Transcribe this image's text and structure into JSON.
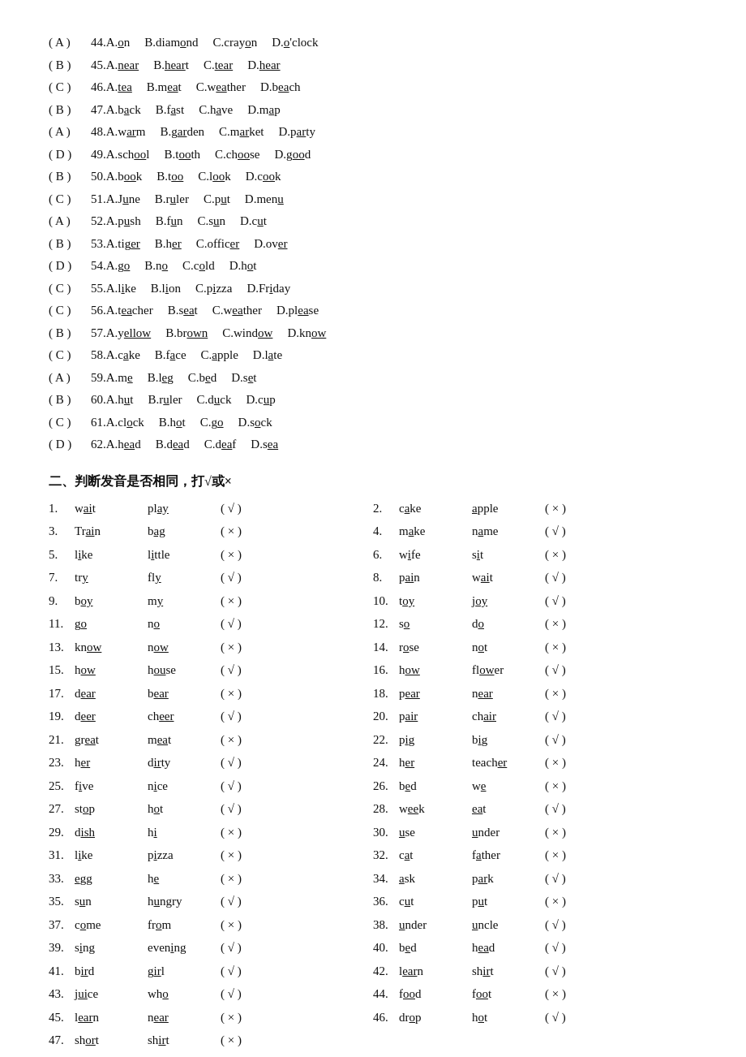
{
  "section1": {
    "title": "",
    "rows": [
      {
        "answer": "( A )",
        "items": [
          "44.A.<u>o</u>n",
          "B.diam<u>o</u>nd",
          "C.cray<u>o</u>n",
          "D.<u>o</u>'clock"
        ]
      },
      {
        "answer": "( B )",
        "items": [
          "45.A.<u>near</u>",
          "B.<u>hear</u>t",
          "C.<u>tear</u>",
          "D.<u>hear</u>"
        ]
      },
      {
        "answer": "( C )",
        "items": [
          "46.A.<u>tea</u>",
          "B.m<u>ea</u>t",
          "C.w<u>ea</u>ther",
          "D.b<u>ea</u>ch"
        ]
      },
      {
        "answer": "( B )",
        "items": [
          "47.A.b<u>a</u>ck",
          "B.f<u>a</u>st",
          "C.h<u>a</u>ve",
          "D.m<u>a</u>p"
        ]
      },
      {
        "answer": "( A )",
        "items": [
          "48.A.w<u>ar</u>m",
          "B.g<u>ar</u>den",
          "C.m<u>ar</u>ket",
          "D.p<u>ar</u>ty"
        ]
      },
      {
        "answer": "( D )",
        "items": [
          "49.A.sch<u>oo</u>l",
          "B.t<u>oo</u>th",
          "C.ch<u>oo</u>se",
          "D.g<u>oo</u>d"
        ]
      },
      {
        "answer": "( B )",
        "items": [
          "50.A.b<u>oo</u>k",
          "B.t<u>oo</u>",
          "C.l<u>oo</u>k",
          "D.c<u>oo</u>k"
        ]
      },
      {
        "answer": "( C )",
        "items": [
          "51.A.J<u>u</u>ne",
          "B.r<u>u</u>ler",
          "C.p<u>u</u>t",
          "D.men<u>u</u>"
        ]
      },
      {
        "answer": "( A )",
        "items": [
          "52.A.p<u>u</u>sh",
          "B.f<u>u</u>n",
          "C.s<u>u</u>n",
          "D.c<u>u</u>t"
        ]
      },
      {
        "answer": "( B )",
        "items": [
          "53.A.tig<u>er</u>",
          "B.h<u>er</u>",
          "C.offic<u>er</u>",
          "D.ov<u>er</u>"
        ]
      },
      {
        "answer": "( D )",
        "items": [
          "54.A.g<u>o</u>",
          "B.n<u>o</u>",
          "C.c<u>o</u>ld",
          "D.h<u>o</u>t"
        ]
      },
      {
        "answer": "( C )",
        "items": [
          "55.A.l<u>i</u>ke",
          "B.l<u>i</u>on",
          "C.p<u>i</u>zza",
          "D.Fr<u>i</u>day"
        ]
      },
      {
        "answer": "( C )",
        "items": [
          "56.A.t<u>ea</u>cher",
          "B.s<u>ea</u>t",
          "C.w<u>ea</u>ther",
          "D.pl<u>ea</u>se"
        ]
      },
      {
        "answer": "( B )",
        "items": [
          "57.A.y<u>ellow</u>",
          "B.br<u>own</u>",
          "C.wind<u>ow</u>",
          "D.kn<u>ow</u>"
        ]
      },
      {
        "answer": "( C )",
        "items": [
          "58.A.c<u>a</u>ke",
          "B.f<u>a</u>ce",
          "C.<u>a</u>pple",
          "D.l<u>a</u>te"
        ]
      },
      {
        "answer": "( A )",
        "items": [
          "59.A.m<u>e</u>",
          "B.l<u>e</u>g",
          "C.b<u>e</u>d",
          "D.s<u>e</u>t"
        ]
      },
      {
        "answer": "( B )",
        "items": [
          "60.A.h<u>u</u>t",
          "B.r<u>u</u>ler",
          "C.d<u>u</u>ck",
          "D.c<u>u</u>p"
        ]
      },
      {
        "answer": "( C )",
        "items": [
          "61.A.cl<u>o</u>ck",
          "B.h<u>o</u>t",
          "C.g<u>o</u>",
          "D.s<u>o</u>ck"
        ]
      },
      {
        "answer": "( D )",
        "items": [
          "62.A.h<u>ea</u>d",
          "B.d<u>ea</u>d",
          "C.d<u>ea</u>f",
          "D.s<u>ea</u>"
        ]
      }
    ]
  },
  "section2": {
    "title": "二、判断发音是否相同，打√或×",
    "items": [
      {
        "num": "1.",
        "w1": "w<u>ai</u>t",
        "w2": "pl<u>ay</u>",
        "extra": "",
        "mark": "( √ )",
        "col": 1
      },
      {
        "num": "2.",
        "w1": "c<u>a</u>ke",
        "w2": "<u>a</u>pple",
        "extra": "",
        "mark": "( × )",
        "col": 2
      },
      {
        "num": "3.",
        "w1": "Tr<u>ai</u>n",
        "w2": "b<u>ag</u>",
        "extra": "",
        "mark": "( × )",
        "col": 1
      },
      {
        "num": "4.",
        "w1": "m<u>a</u>ke",
        "w2": "n<u>a</u>me",
        "extra": "",
        "mark": "( √ )",
        "col": 2
      },
      {
        "num": "5.",
        "w1": "l<u>i</u>ke",
        "w2": "l<u>i</u>ttle",
        "extra": "",
        "mark": "( × )",
        "col": 1
      },
      {
        "num": "6.",
        "w1": "w<u>i</u>fe",
        "w2": "s<u>i</u>t",
        "extra": "",
        "mark": "( × )",
        "col": 2
      },
      {
        "num": "7.",
        "w1": "tr<u>y</u>",
        "w2": "fl<u>y</u>",
        "extra": "",
        "mark": "( √ )",
        "col": 1
      },
      {
        "num": "8.",
        "w1": "p<u>ai</u>n",
        "w2": "w<u>ai</u>t",
        "extra": "",
        "mark": "( √ )",
        "col": 2
      },
      {
        "num": "9.",
        "w1": "b<u>oy</u>",
        "w2": "m<u>y</u>",
        "extra": "",
        "mark": "( × )",
        "col": 1
      },
      {
        "num": "10.",
        "w1": "t<u>oy</u>",
        "w2": "j<u>oy</u>",
        "extra": "",
        "mark": "( √ )",
        "col": 2
      },
      {
        "num": "11.",
        "w1": "g<u>o</u>",
        "w2": "n<u>o</u>",
        "extra": "",
        "mark": "( √ )",
        "col": 1
      },
      {
        "num": "12.",
        "w1": "s<u>o</u>",
        "w2": "d<u>o</u>",
        "extra": "",
        "mark": "( × )",
        "col": 2
      },
      {
        "num": "13.",
        "w1": "kn<u>ow</u>",
        "w2": "n<u>ow</u>",
        "extra": "",
        "mark": "( × )",
        "col": 1
      },
      {
        "num": "14.",
        "w1": "r<u>o</u>se",
        "w2": "n<u>o</u>t",
        "extra": "",
        "mark": "( × )",
        "col": 2
      },
      {
        "num": "15.",
        "w1": "h<u>ow</u>",
        "w2": "h<u>ou</u>se",
        "extra": "",
        "mark": "( √ )",
        "col": 1
      },
      {
        "num": "16.",
        "w1": "h<u>ow</u>",
        "w2": "fl<u>ow</u>er",
        "extra": "",
        "mark": "( √ )",
        "col": 2
      },
      {
        "num": "17.",
        "w1": "d<u>ear</u>",
        "w2": "b<u>ear</u>",
        "extra": "",
        "mark": "( × )",
        "col": 1
      },
      {
        "num": "18.",
        "w1": "p<u>ear</u>",
        "w2": "n<u>ear</u>",
        "extra": "",
        "mark": "( × )",
        "col": 2
      },
      {
        "num": "19.",
        "w1": "d<u>eer</u>",
        "w2": "ch<u>eer</u>",
        "extra": "",
        "mark": "( √ )",
        "col": 1
      },
      {
        "num": "20.",
        "w1": "p<u>air</u>",
        "w2": "ch<u>air</u>",
        "extra": "",
        "mark": "( √ )",
        "col": 2
      },
      {
        "num": "21.",
        "w1": "gr<u>ea</u>t",
        "w2": "m<u>ea</u>t",
        "extra": "",
        "mark": "( × )",
        "col": 1
      },
      {
        "num": "22.",
        "w1": "p<u>i</u>g",
        "w2": "b<u>i</u>g",
        "extra": "",
        "mark": "( √ )",
        "col": 2
      },
      {
        "num": "23.",
        "w1": "h<u>er</u>",
        "w2": "d<u>ir</u>ty",
        "extra": "",
        "mark": "( √ )",
        "col": 1
      },
      {
        "num": "24.",
        "w1": "h<u>er</u>",
        "w2": "teach<u>er</u>",
        "extra": "",
        "mark": "( × )",
        "col": 2
      },
      {
        "num": "25.",
        "w1": "f<u>i</u>ve",
        "w2": "n<u>i</u>ce",
        "extra": "",
        "mark": "( √ )",
        "col": 1
      },
      {
        "num": "26.",
        "w1": "b<u>e</u>d",
        "w2": "w<u>e</u>",
        "extra": "",
        "mark": "( × )",
        "col": 2
      },
      {
        "num": "27.",
        "w1": "st<u>o</u>p",
        "w2": "h<u>o</u>t",
        "extra": "",
        "mark": "( √ )",
        "col": 1
      },
      {
        "num": "28.",
        "w1": "w<u>ee</u>k",
        "w2": "<u>ea</u>t",
        "extra": "",
        "mark": "( √ )",
        "col": 2
      },
      {
        "num": "29.",
        "w1": "d<u>ish</u>",
        "w2": "h<u>i</u>",
        "extra": "",
        "mark": "( × )",
        "col": 1
      },
      {
        "num": "30.",
        "w1": "<u>u</u>se",
        "w2": "<u>u</u>nder",
        "extra": "",
        "mark": "( × )",
        "col": 2
      },
      {
        "num": "31.",
        "w1": "l<u>i</u>ke",
        "w2": "p<u>i</u>zza",
        "extra": "",
        "mark": "( × )",
        "col": 1
      },
      {
        "num": "32.",
        "w1": "c<u>a</u>t",
        "w2": "f<u>a</u>ther",
        "extra": "",
        "mark": "( × )",
        "col": 2
      },
      {
        "num": "33.",
        "w1": "<u>e</u>gg",
        "w2": "h<u>e</u>",
        "extra": "",
        "mark": "( × )",
        "col": 1
      },
      {
        "num": "34.",
        "w1": "<u>a</u>sk",
        "w2": "p<u>ar</u>k",
        "extra": "",
        "mark": "( √ )",
        "col": 2
      },
      {
        "num": "35.",
        "w1": "s<u>u</u>n",
        "w2": "h<u>u</u>ngry",
        "extra": "",
        "mark": "( √ )",
        "col": 1
      },
      {
        "num": "36.",
        "w1": "c<u>u</u>t",
        "w2": "p<u>u</u>t",
        "extra": "",
        "mark": "( × )",
        "col": 2
      },
      {
        "num": "37.",
        "w1": "c<u>o</u>me",
        "w2": "fr<u>o</u>m",
        "extra": "",
        "mark": "( × )",
        "col": 1
      },
      {
        "num": "38.",
        "w1": "<u>u</u>nder",
        "w2": "<u>u</u>ncle",
        "extra": "",
        "mark": "( √ )",
        "col": 2
      },
      {
        "num": "39.",
        "w1": "s<u>i</u>ng",
        "w2": "even<u>i</u>ng",
        "extra": "( √ )",
        "mark": "",
        "col": 1
      },
      {
        "num": "40.",
        "w1": "b<u>e</u>d",
        "w2": "h<u>ea</u>d",
        "extra": "",
        "mark": "( √ )",
        "col": 2
      },
      {
        "num": "41.",
        "w1": "b<u>ir</u>d",
        "w2": "g<u>ir</u>l",
        "extra": "",
        "mark": "( √ )",
        "col": 1
      },
      {
        "num": "42.",
        "w1": "l<u>ear</u>n",
        "w2": "sh<u>ir</u>t",
        "extra": "",
        "mark": "( √ )",
        "col": 2
      },
      {
        "num": "43.",
        "w1": "j<u>ui</u>ce",
        "w2": "wh<u>o</u>",
        "extra": "",
        "mark": "( √ )",
        "col": 1
      },
      {
        "num": "44.",
        "w1": "f<u>oo</u>d",
        "w2": "f<u>oo</u>t",
        "extra": "",
        "mark": "( × )",
        "col": 2
      },
      {
        "num": "45.",
        "w1": "l<u>ear</u>n",
        "w2": "n<u>ear</u>",
        "extra": "",
        "mark": "( × )",
        "col": 1
      },
      {
        "num": "46.",
        "w1": "dr<u>o</u>p",
        "w2": "h<u>o</u>t",
        "extra": "",
        "mark": "( √ )",
        "col": 2
      },
      {
        "num": "47.",
        "w1": "sh<u>or</u>t",
        "w2": "sh<u>ir</u>t",
        "extra": "",
        "mark": "( × )",
        "col": 1
      }
    ]
  }
}
